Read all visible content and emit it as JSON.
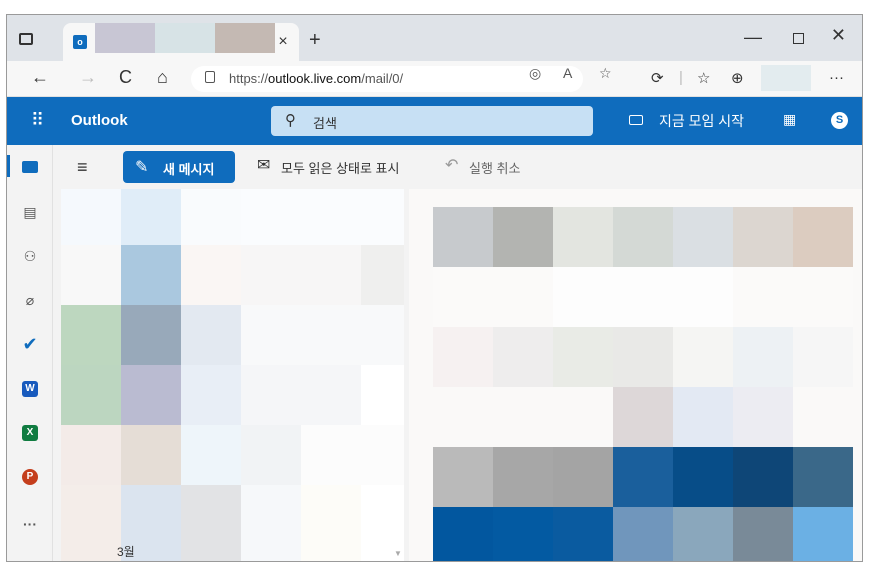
{
  "browser": {
    "tab_close": "×",
    "new_tab": "+",
    "win_min": "—",
    "win_close": "✕",
    "back": "←",
    "forward": "→",
    "refresh": "C",
    "home": "⌂",
    "url_prefix": "https://",
    "url_host": "outlook.live.com",
    "url_path": "/mail/0/",
    "read_aloud": "A",
    "more": "···"
  },
  "outlook": {
    "brand": "Outlook",
    "search_placeholder": "검색",
    "meet_now": "지금 모임 시작",
    "skype_letter": "S",
    "rail": {
      "word": "W",
      "excel": "X",
      "powerpoint": "P",
      "more": "···"
    },
    "commands": {
      "new_message": "새 메시지",
      "mark_all_read": "모두 읽은 상태로 표시",
      "undo": "실행 취소"
    },
    "list": {
      "month_label": "3월"
    }
  },
  "colors": {
    "brand_blue": "#0f6cbd",
    "search_bg": "#c7e0f4",
    "tab_strip": "#dfe3e8"
  }
}
